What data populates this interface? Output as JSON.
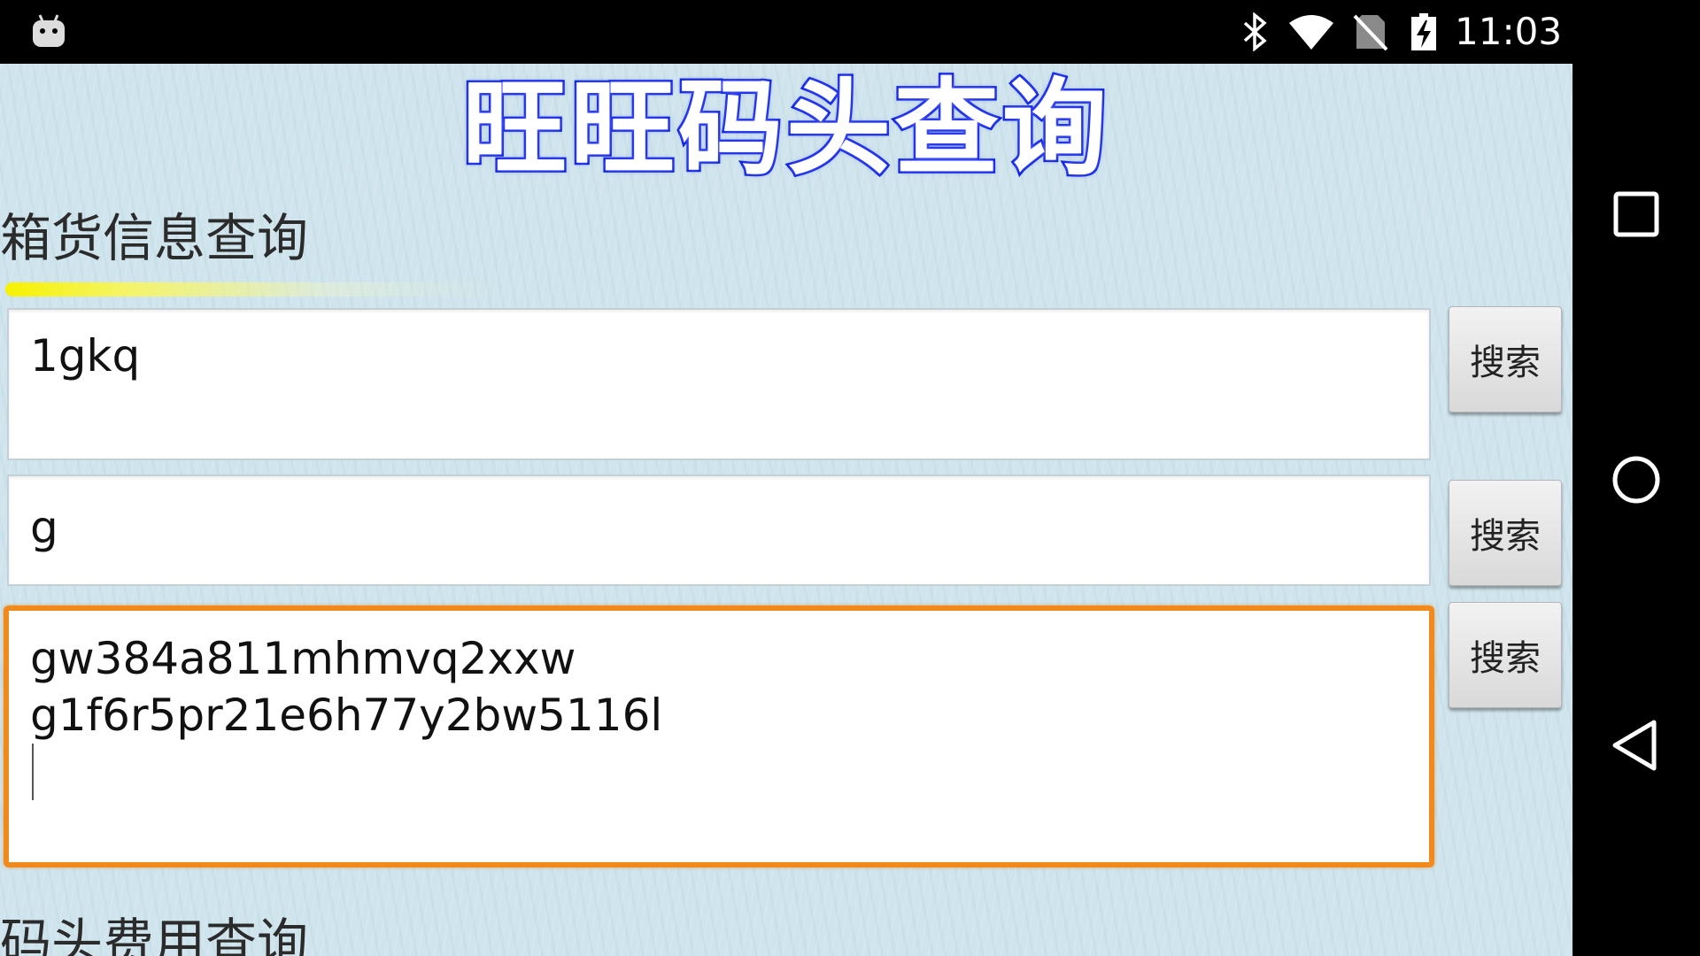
{
  "status_bar": {
    "time": "11:03",
    "icons": [
      "android-debug-icon",
      "bluetooth-icon",
      "wifi-icon",
      "no-sim-icon",
      "battery-charging-icon"
    ]
  },
  "app": {
    "title": "旺旺码头查询",
    "sections": {
      "cargo_title": "箱货信息查询",
      "fees_title": "码头费用查询"
    },
    "fields": [
      {
        "value": "1gkq",
        "button_label": "搜索"
      },
      {
        "value": "g",
        "button_label": "搜索"
      },
      {
        "value": "gw384a811mhmvq2xxw\ng1f6r5pr21e6h77y2bw5116l",
        "button_label": "搜索",
        "focused": true
      }
    ],
    "colors": {
      "background": "#cfe4ec",
      "title_stroke": "#0b1fe0",
      "focus_border": "#f08a1c",
      "highlight_bar": "#f6f200"
    }
  },
  "nav_bar": {
    "buttons": [
      "recents-icon",
      "home-icon",
      "back-icon"
    ]
  }
}
